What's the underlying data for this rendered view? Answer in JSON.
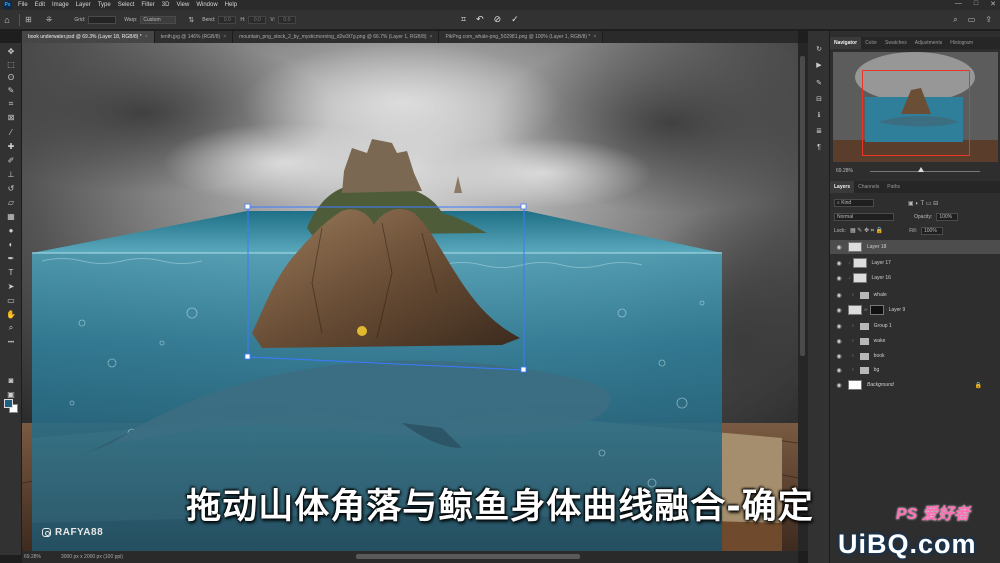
{
  "menubar": {
    "logo": "Ps",
    "items": [
      "File",
      "Edit",
      "Image",
      "Layer",
      "Type",
      "Select",
      "Filter",
      "3D",
      "View",
      "Window",
      "Help"
    ],
    "window_controls": [
      "—",
      "□",
      "✕"
    ]
  },
  "options": {
    "grid_label": "Grid:",
    "grid_value": "",
    "warp_label": "Warp:",
    "warp_value": "Custom",
    "bend_label": "Bend:",
    "h_label": "H:",
    "v_label": "V:",
    "bend_value": "0.0",
    "h_value": "0.0",
    "v_value": "0.0"
  },
  "tabs": [
    {
      "label": "book underwater.psd @ 69.3% (Layer 18, RGB/8) *",
      "active": true
    },
    {
      "label": "tenth.jpg @ 146% (RGB/8)",
      "active": false
    },
    {
      "label": "mountain_png_stock_2_by_mysticmorning_d2w3t7g.png @ 66.7% (Layer 1, RGB/8)",
      "active": false
    },
    {
      "label": "PikPng.com_whale-png_502981.png @ 100% (Layer 1, RGB/8) *",
      "active": false
    }
  ],
  "status": {
    "zoom": "69.28%",
    "doc_info": "3000 px x 2000 px (100 ppi)"
  },
  "caption": "拖动山体角落与鲸鱼身体曲线融合-确定",
  "instagram": "RAFYA88",
  "panels": {
    "top_tabs": [
      "Navigator",
      "Color",
      "Swatches",
      "Adjustments",
      "Histogram"
    ],
    "nav_zoom": "69.28%",
    "layer_tabs": [
      "Layers",
      "Channels",
      "Paths"
    ],
    "kind_label": "Kind",
    "blend_mode": "Normal",
    "opacity_label": "Opacity:",
    "opacity": "100%",
    "lock_label": "Lock:",
    "fill_label": "Fill:",
    "fill": "100%"
  },
  "layers": [
    {
      "name": "Layer 18",
      "type": "layer",
      "selected": true
    },
    {
      "name": "Layer 17",
      "type": "layer",
      "selected": false
    },
    {
      "name": "Layer 16",
      "type": "layer",
      "selected": false
    },
    {
      "name": "whale",
      "type": "group",
      "selected": false
    },
    {
      "name": "Layer 9",
      "type": "layer-mask",
      "selected": false
    },
    {
      "name": "Group 1",
      "type": "group",
      "selected": false
    },
    {
      "name": "wake",
      "type": "group",
      "selected": false
    },
    {
      "name": "book",
      "type": "group",
      "selected": false
    },
    {
      "name": "bg",
      "type": "group",
      "selected": false
    },
    {
      "name": "Background",
      "type": "background",
      "selected": false
    }
  ],
  "watermark": {
    "site": "UiBQ.com",
    "ps": "PS 爱好者"
  },
  "colors": {
    "foreground": "#1d5f7c",
    "background": "#ffffff",
    "accent": "#31a8ff"
  }
}
